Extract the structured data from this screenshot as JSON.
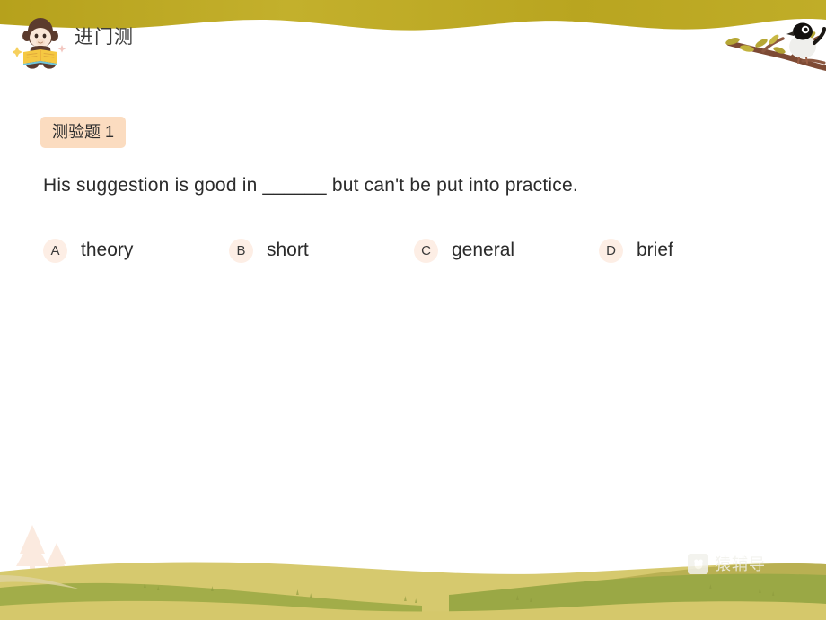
{
  "header": {
    "title": "进门测",
    "mascot_icon": "monkey-reading-book-icon",
    "bird_icon": "bird-on-branch-icon",
    "band_color": "#b8a41e"
  },
  "question": {
    "badge_label": "测验题 1",
    "badge_color": "#fbdcc0",
    "stem": "His suggestion is good in ______ but can't be put into practice.",
    "options": [
      {
        "letter": "A",
        "text": "theory"
      },
      {
        "letter": "B",
        "text": "short"
      },
      {
        "letter": "C",
        "text": "general"
      },
      {
        "letter": "D",
        "text": "brief"
      }
    ],
    "option_badge_color": "#fdeee5"
  },
  "footer": {
    "watermark_text": "猿辅导",
    "watermark_logo_icon": "yuanfudao-logo-icon",
    "hill_colors": [
      "#cdc05e",
      "#d4c466",
      "#9aa845",
      "#d9cc72"
    ],
    "tree_icon": "pine-tree-icon"
  }
}
